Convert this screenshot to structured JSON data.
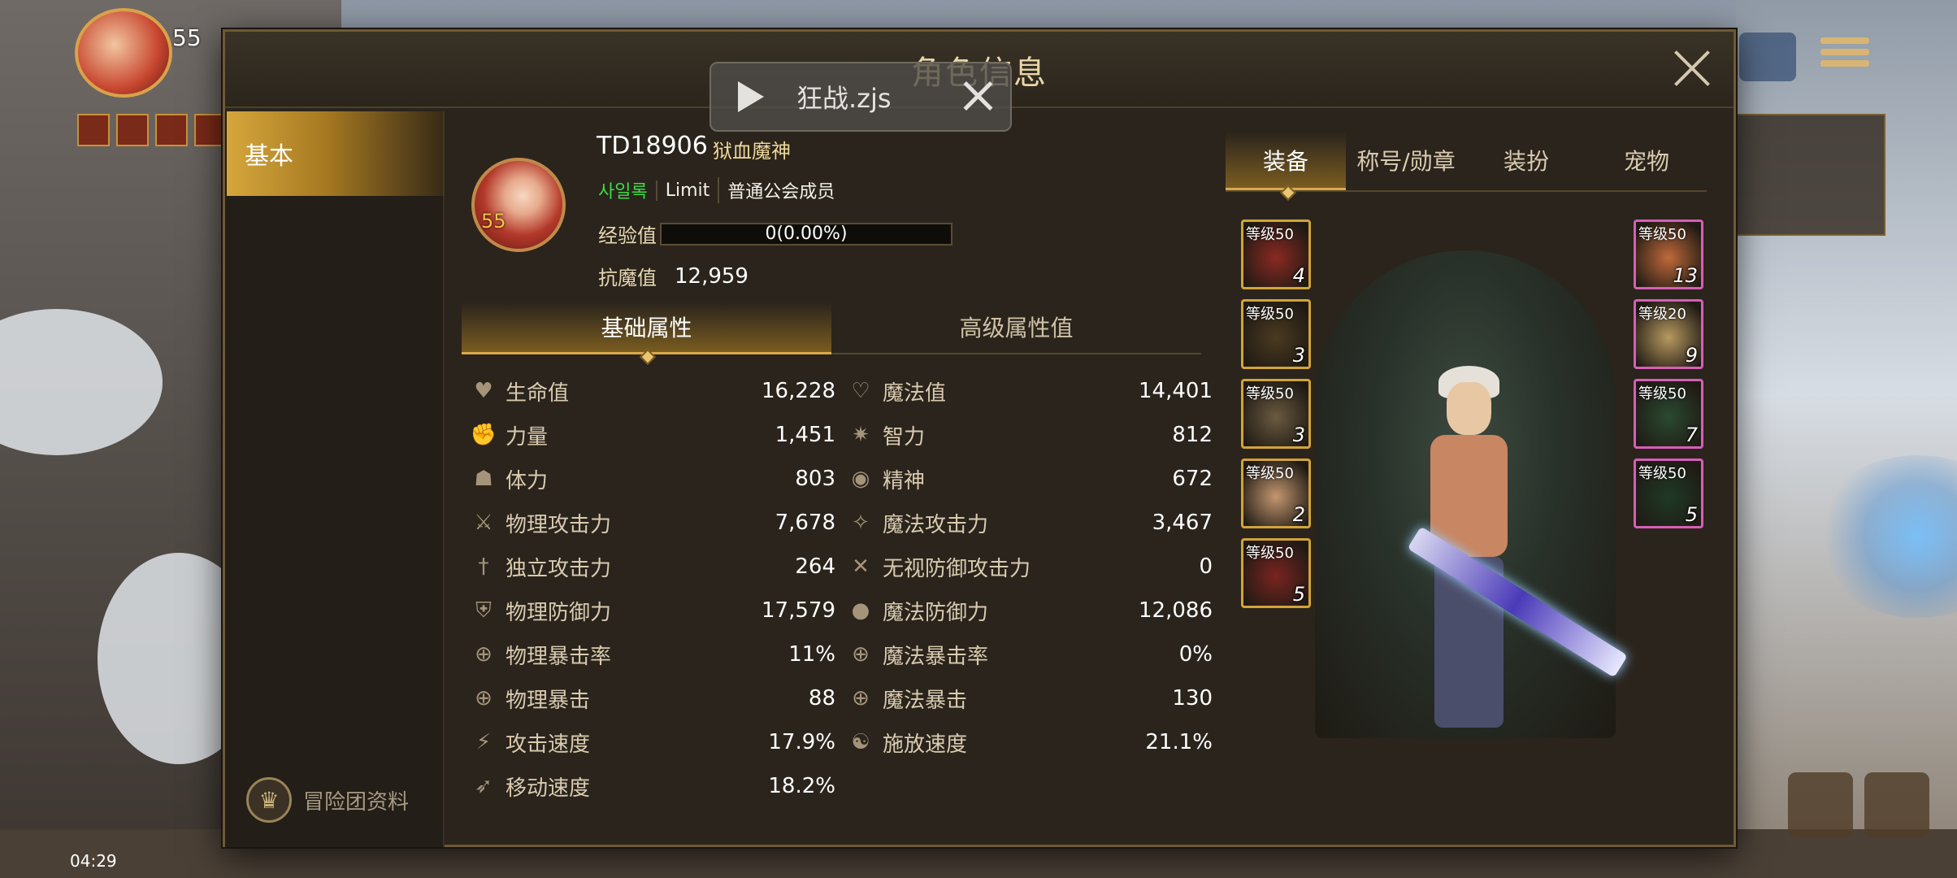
{
  "dialog": {
    "title": "角色信息"
  },
  "hud": {
    "level": "55",
    "time": "04:29"
  },
  "media": {
    "file_name": "狂战.zjs"
  },
  "nav": {
    "basic_label": "基本",
    "adventure_label": "冒险团资料"
  },
  "character": {
    "name": "TD18906",
    "class": "狱血魔神",
    "avatar_level": "55",
    "tag": "사일록",
    "limit": "Limit",
    "guild_rank": "普通公会成员",
    "exp_label": "经验值",
    "exp_value": "0(0.00%)",
    "resist_label": "抗魔值",
    "resist_value": "12,959"
  },
  "stat_tabs": {
    "basic": "基础属性",
    "advanced": "高级属性值"
  },
  "stats_left": [
    {
      "icon": "heart-icon",
      "label": "生命值",
      "value": "16,228"
    },
    {
      "icon": "strength-icon",
      "label": "力量",
      "value": "1,451"
    },
    {
      "icon": "vitality-icon",
      "label": "体力",
      "value": "803"
    },
    {
      "icon": "sword-icon",
      "label": "物理攻击力",
      "value": "7,678"
    },
    {
      "icon": "dagger-icon",
      "label": "独立攻击力",
      "value": "264"
    },
    {
      "icon": "shield-icon",
      "label": "物理防御力",
      "value": "17,579"
    },
    {
      "icon": "crosshair-icon",
      "label": "物理暴击率",
      "value": "11%"
    },
    {
      "icon": "crosshair-icon",
      "label": "物理暴击",
      "value": "88"
    },
    {
      "icon": "attack-speed-icon",
      "label": "攻击速度",
      "value": "17.9%"
    },
    {
      "icon": "boot-icon",
      "label": "移动速度",
      "value": "18.2%"
    }
  ],
  "stats_right": [
    {
      "icon": "heart-outline-icon",
      "label": "魔法值",
      "value": "14,401"
    },
    {
      "icon": "intelligence-icon",
      "label": "智力",
      "value": "812"
    },
    {
      "icon": "eye-icon",
      "label": "精神",
      "value": "672"
    },
    {
      "icon": "magic-attack-icon",
      "label": "魔法攻击力",
      "value": "3,467"
    },
    {
      "icon": "ignore-defense-icon",
      "label": "无视防御攻击力",
      "value": "0"
    },
    {
      "icon": "orb-icon",
      "label": "魔法防御力",
      "value": "12,086"
    },
    {
      "icon": "crosshair-icon",
      "label": "魔法暴击率",
      "value": "0%"
    },
    {
      "icon": "crosshair-icon",
      "label": "魔法暴击",
      "value": "130"
    },
    {
      "icon": "cast-speed-icon",
      "label": "施放速度",
      "value": "21.1%"
    }
  ],
  "equip_tabs": [
    "装备",
    "称号/勋章",
    "装扮",
    "宠物"
  ],
  "left_slots": [
    {
      "level": "等级50",
      "count": "4",
      "color": "#8a2a22"
    },
    {
      "level": "等级50",
      "count": "3",
      "color": "#4a3a20"
    },
    {
      "level": "等级50",
      "count": "3",
      "color": "#6a5a40"
    },
    {
      "level": "等级50",
      "count": "2",
      "color": "#c49770"
    },
    {
      "level": "等级50",
      "count": "5",
      "color": "#7a2420"
    }
  ],
  "right_slots": [
    {
      "level": "等级50",
      "count": "13",
      "color": "#c06a3a"
    },
    {
      "level": "等级20",
      "count": "9",
      "color": "#b89a60"
    },
    {
      "level": "等级50",
      "count": "7",
      "color": "#2a4a30"
    },
    {
      "level": "等级50",
      "count": "5",
      "color": "#1f3a26"
    }
  ]
}
